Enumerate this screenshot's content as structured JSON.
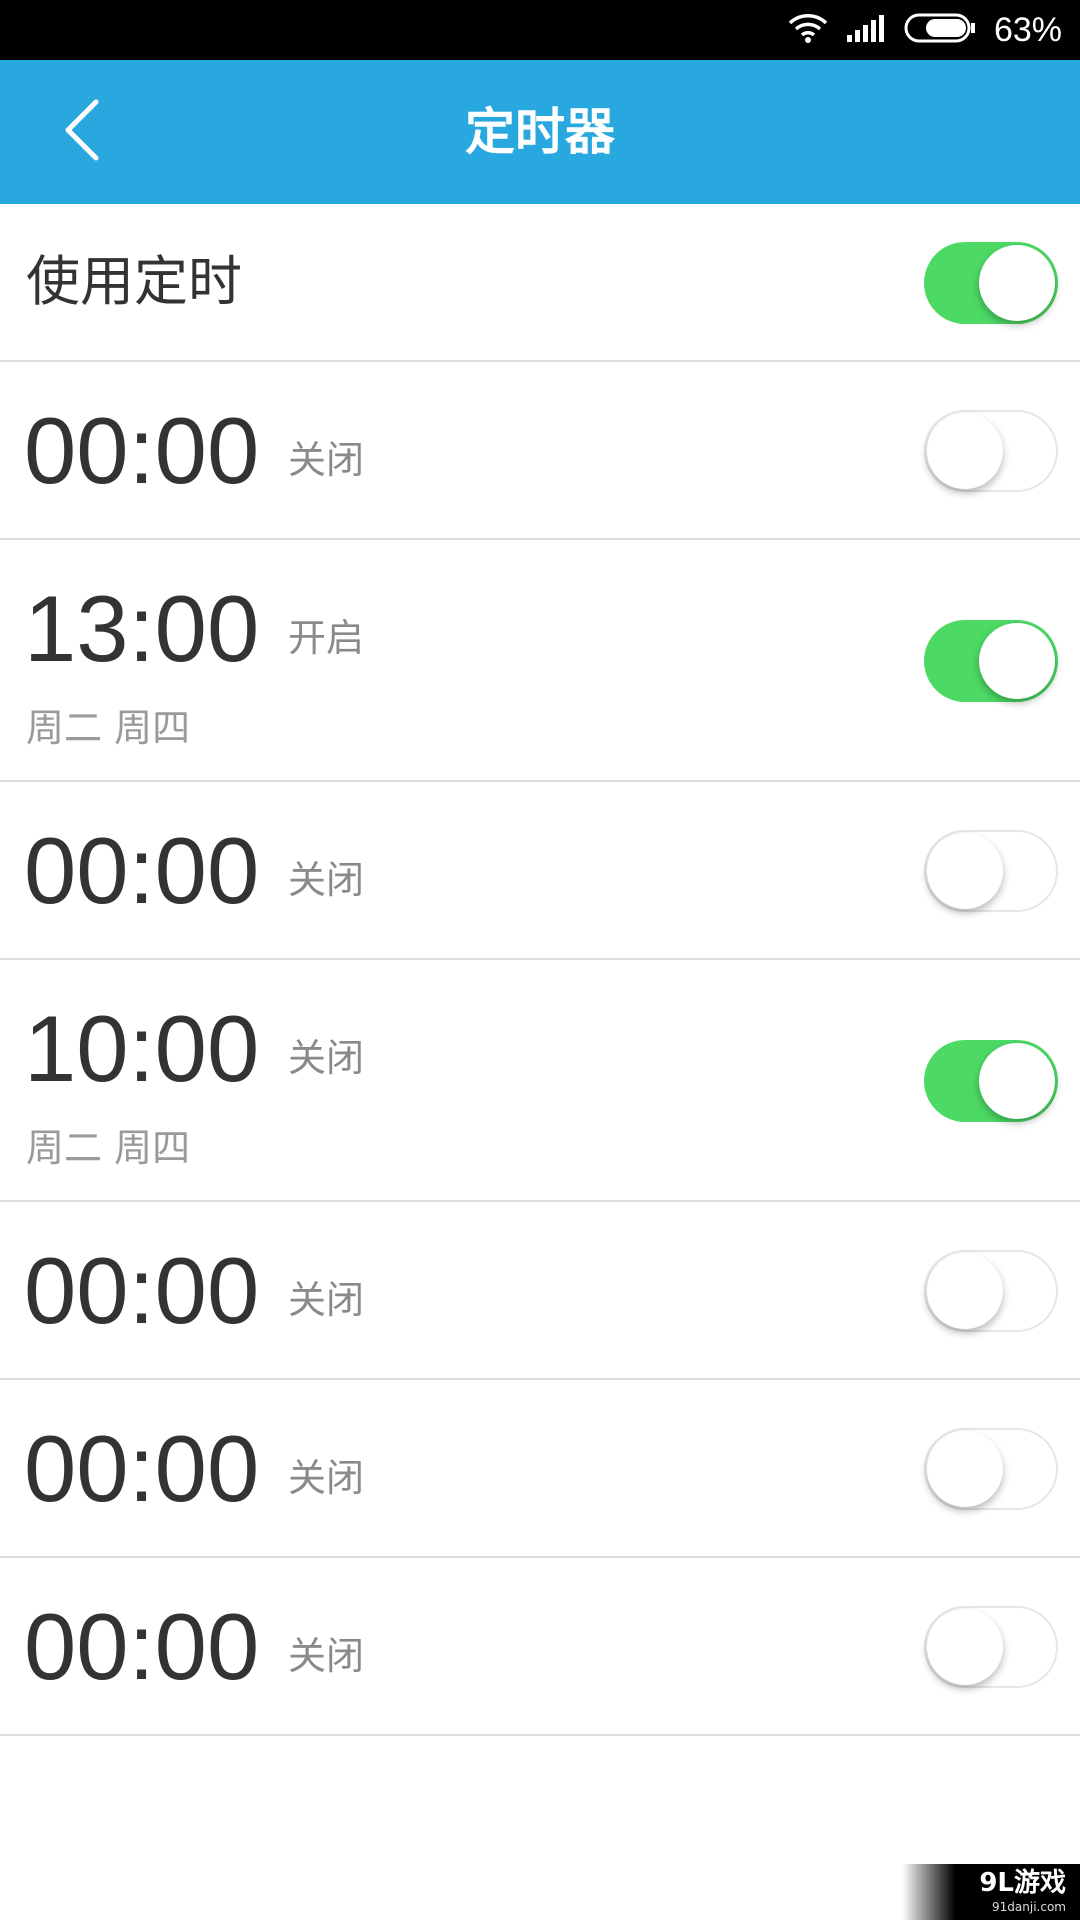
{
  "status_bar": {
    "battery_percent": "63%",
    "icons": [
      "wifi-icon",
      "signal-icon",
      "battery-icon"
    ],
    "battery_level": 0.63
  },
  "header": {
    "title": "定时器",
    "back_icon": "chevron-left-icon",
    "background": "#29a8e0"
  },
  "master_switch": {
    "label": "使用定时",
    "enabled": true
  },
  "timers": [
    {
      "time": "00:00",
      "state": "关闭",
      "days": "",
      "enabled": false
    },
    {
      "time": "13:00",
      "state": "开启",
      "days": "周二 周四",
      "enabled": true
    },
    {
      "time": "00:00",
      "state": "关闭",
      "days": "",
      "enabled": false
    },
    {
      "time": "10:00",
      "state": "关闭",
      "days": "周二 周四",
      "enabled": true
    },
    {
      "time": "00:00",
      "state": "关闭",
      "days": "",
      "enabled": false
    },
    {
      "time": "00:00",
      "state": "关闭",
      "days": "",
      "enabled": false
    },
    {
      "time": "00:00",
      "state": "关闭",
      "days": "",
      "enabled": false
    }
  ],
  "colors": {
    "toggle_on": "#4cd964",
    "toggle_off": "#ffffff",
    "divider": "#dcdcdc"
  },
  "watermark": {
    "logo": "9L游戏",
    "url": "91danji.com"
  }
}
